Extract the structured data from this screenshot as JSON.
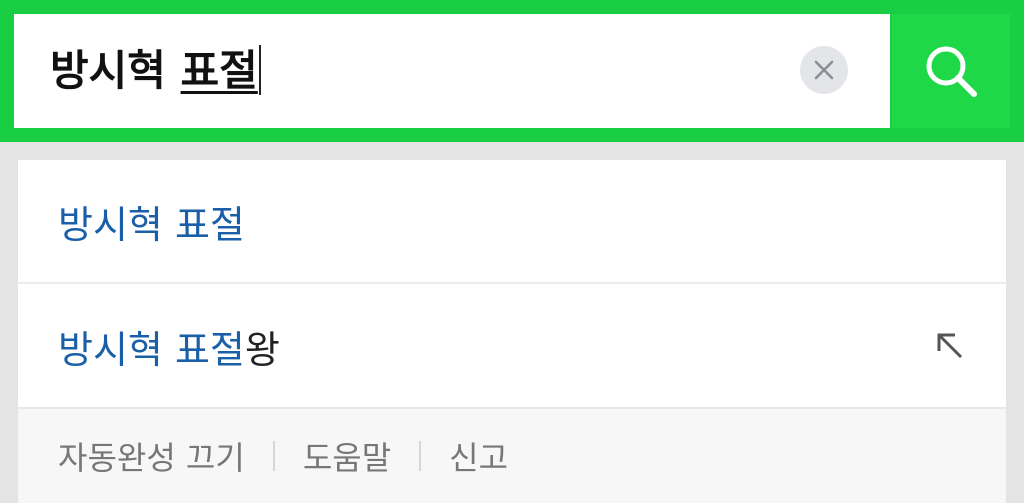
{
  "search": {
    "query_prefix": "방시혁 ",
    "query_composing": "표절",
    "clear_icon": "close-icon",
    "search_icon": "search-icon",
    "accent_color": "#19ce43"
  },
  "suggestions": [
    {
      "highlight": "방시혁 표절",
      "rest": ""
    },
    {
      "highlight": "방시혁 표절",
      "rest": "왕",
      "arrow_icon": "arrow-up-left-icon"
    }
  ],
  "footer": {
    "autocomplete_off": "자동완성 끄기",
    "help": "도움말",
    "report": "신고"
  },
  "colors": {
    "highlight_text": "#1a5fa8",
    "footer_text": "#777777"
  }
}
